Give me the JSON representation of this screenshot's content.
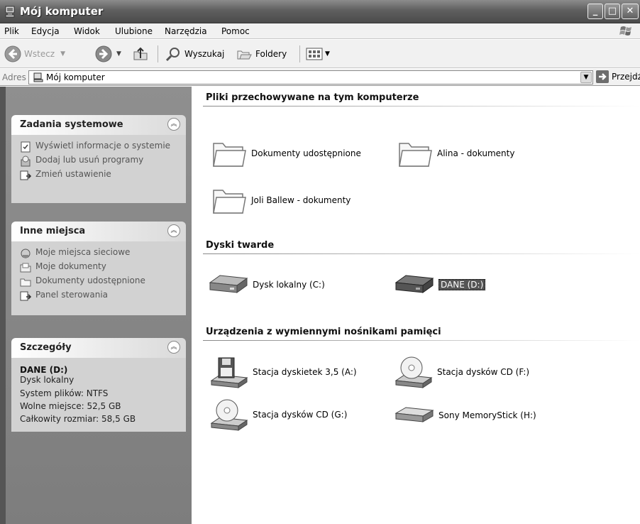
{
  "window": {
    "title": "Mój komputer"
  },
  "menu": [
    "Plik",
    "Edycja",
    "Widok",
    "Ulubione",
    "Narzędzia",
    "Pomoc"
  ],
  "toolbar": {
    "back": "Wstecz",
    "search": "Wyszukaj",
    "folders": "Foldery"
  },
  "address": {
    "label": "Adres",
    "value": "Mój komputer",
    "go": "Przejdź"
  },
  "left": {
    "system_tasks": {
      "title": "Zadania systemowe",
      "items": [
        "Wyświetl informacje o systemie",
        "Dodaj lub usuń programy",
        "Zmień ustawienie"
      ]
    },
    "other_places": {
      "title": "Inne miejsca",
      "items": [
        "Moje miejsca sieciowe",
        "Moje dokumenty",
        "Dokumenty udostępnione",
        "Panel sterowania"
      ]
    },
    "details": {
      "title": "Szczegóły",
      "name": "DANE (D:)",
      "type": "Dysk lokalny",
      "fs": "System plików: NTFS",
      "free": "Wolne miejsce: 52,5 GB",
      "total": "Całkowity rozmiar: 58,5 GB"
    }
  },
  "groups": {
    "stored": {
      "title": "Pliki przechowywane na tym komputerze",
      "items": [
        "Dokumenty udostępnione",
        "Alina - dokumenty",
        "Joli Ballew - dokumenty"
      ]
    },
    "hard": {
      "title": "Dyski twarde",
      "items": [
        "Dysk lokalny (C:)",
        "DANE (D:)"
      ]
    },
    "removable": {
      "title": "Urządzenia z wymiennymi nośnikami pamięci",
      "items": [
        "Stacja dyskietek 3,5 (A:)",
        "Stacja dysków CD (F:)",
        "Stacja dysków CD (G:)",
        "Sony MemoryStick (H:)"
      ]
    }
  }
}
